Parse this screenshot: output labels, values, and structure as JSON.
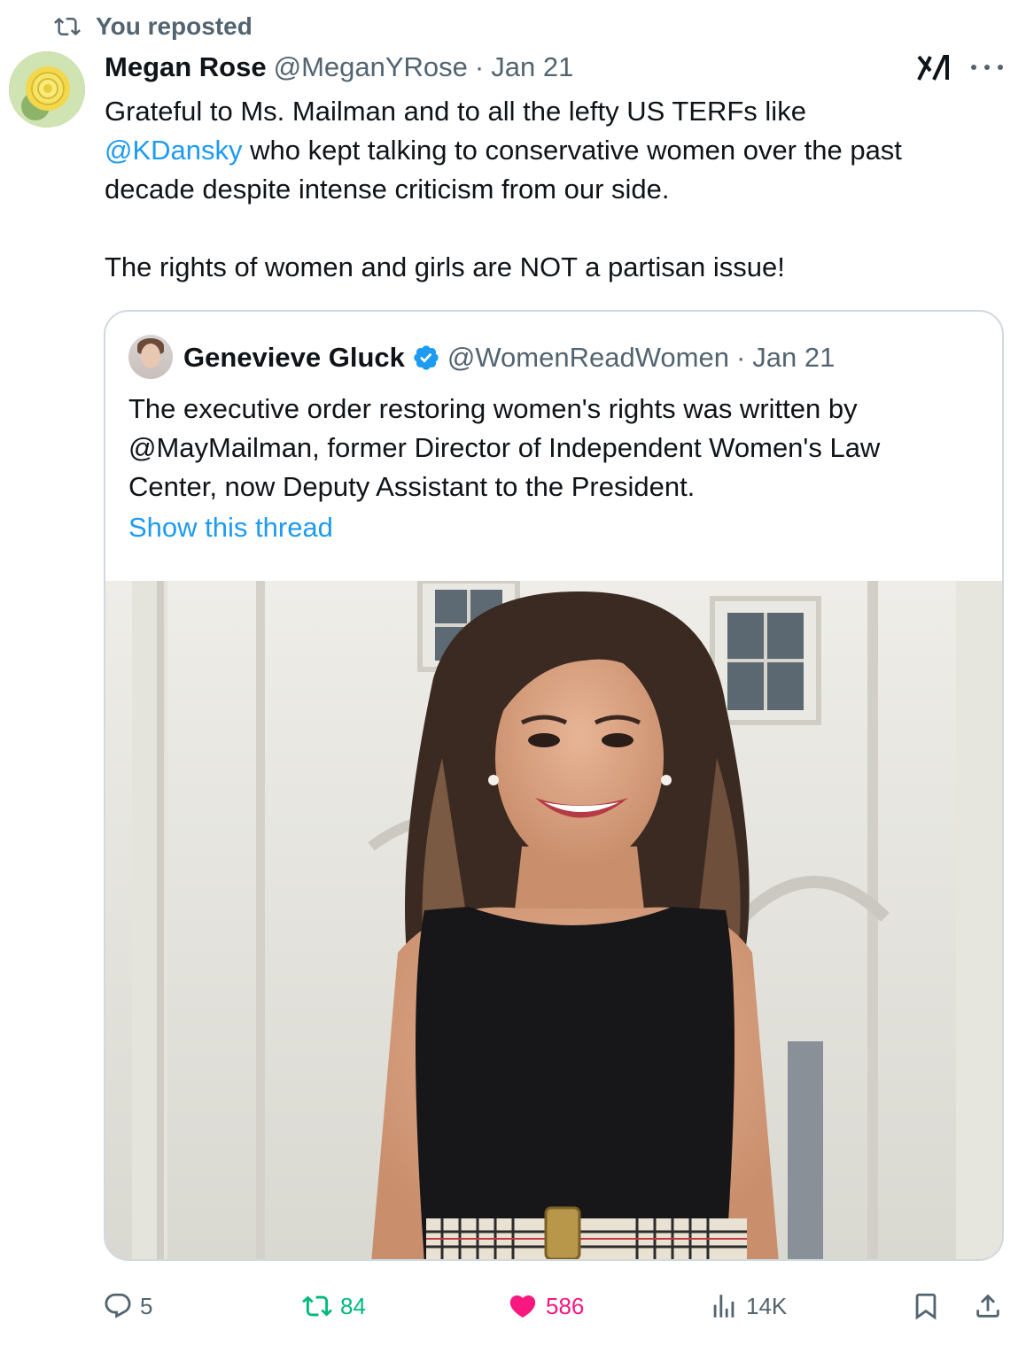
{
  "repost_banner": {
    "text": "You reposted",
    "icon": "repost-icon"
  },
  "post": {
    "author_name": "Megan Rose",
    "handle": "@MeganYRose",
    "separator": "·",
    "date": "Jan 21",
    "text_lines": [
      "Grateful to Ms. Mailman and to all the lefty US TERFs like",
      "who kept talking to conservative women over the past",
      "decade despite intense criticism from our side.",
      "The rights of women and girls are NOT a partisan issue!"
    ],
    "mention": "@KDansky"
  },
  "quote": {
    "author_name": "Genevieve Gluck",
    "handle": "@WomenReadWomen",
    "separator": "·",
    "date": "Jan 21",
    "text_lines": [
      "The executive order restoring women's rights was written by",
      "@MayMailman, former Director of Independent Women's Law",
      "Center, now Deputy Assistant to the President."
    ],
    "show_thread": "Show this thread"
  },
  "actions": {
    "replies": "5",
    "reposts": "84",
    "likes": "586",
    "views": "14K"
  },
  "colors": {
    "accent": "#1d9bf0",
    "muted": "#536471",
    "repost_green": "#00ba7c",
    "like_pink": "#f91880",
    "border": "#cfd9de"
  }
}
